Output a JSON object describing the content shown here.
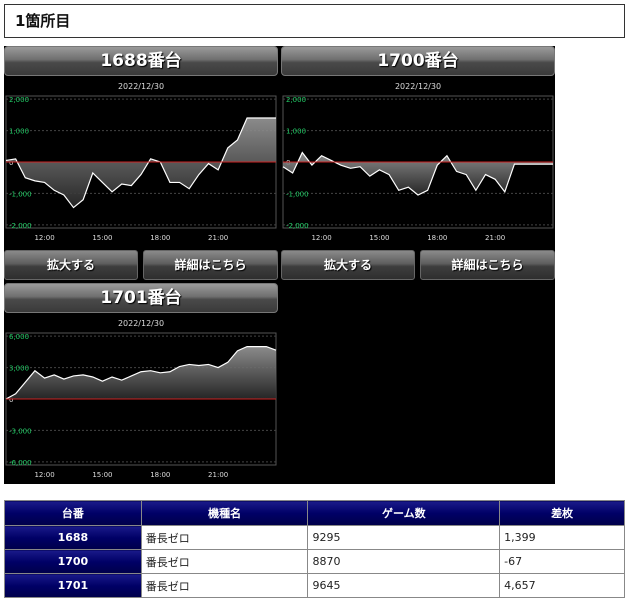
{
  "page": {
    "title": "1箇所目"
  },
  "machines": [
    {
      "title": "1688番台",
      "date": "2022/12/30",
      "zoom_label": "拡大する",
      "detail_label": "詳細はこちら",
      "chart_data": {
        "type": "area",
        "title": "1688番台",
        "subtitle": "2022/12/30",
        "x_ticks": [
          "12:00",
          "15:00",
          "18:00",
          "21:00"
        ],
        "y_ticks": [
          "2,000",
          "1,000",
          "0",
          "-1,000",
          "-2,000"
        ],
        "ylim": [
          -2100,
          2100
        ],
        "xlim": [
          10,
          24
        ],
        "grid": true,
        "series": [
          {
            "x": [
              10,
              10.5,
              11,
              11.5,
              12,
              12.5,
              13,
              13.5,
              14,
              14.5,
              15,
              15.5,
              16,
              16.5,
              17,
              17.5,
              18,
              18.5,
              19,
              19.5,
              20,
              20.5,
              21,
              21.5,
              22,
              22.5,
              23,
              23.5,
              24
            ],
            "y": [
              50,
              100,
              -500,
              -600,
              -650,
              -900,
              -1050,
              -1450,
              -1200,
              -350,
              -650,
              -950,
              -700,
              -750,
              -400,
              100,
              0,
              -650,
              -650,
              -850,
              -400,
              -50,
              -250,
              450,
              700,
              1400,
              1400,
              1400,
              1399
            ]
          }
        ]
      }
    },
    {
      "title": "1700番台",
      "date": "2022/12/30",
      "zoom_label": "拡大する",
      "detail_label": "詳細はこちら",
      "chart_data": {
        "type": "area",
        "title": "1700番台",
        "subtitle": "2022/12/30",
        "x_ticks": [
          "12:00",
          "15:00",
          "18:00",
          "21:00"
        ],
        "y_ticks": [
          "2,000",
          "1,000",
          "0",
          "-1,000",
          "-2,000"
        ],
        "ylim": [
          -2100,
          2100
        ],
        "xlim": [
          10,
          24
        ],
        "grid": true,
        "series": [
          {
            "x": [
              10,
              10.5,
              11,
              11.5,
              12,
              12.5,
              13,
              13.5,
              14,
              14.5,
              15,
              15.5,
              16,
              16.5,
              17,
              17.5,
              18,
              18.5,
              19,
              19.5,
              20,
              20.5,
              21,
              21.5,
              22,
              22.5,
              23,
              23.5,
              24
            ],
            "y": [
              -150,
              -350,
              300,
              -100,
              200,
              50,
              -100,
              -200,
              -150,
              -450,
              -250,
              -400,
              -900,
              -800,
              -1050,
              -900,
              -100,
              200,
              -300,
              -400,
              -900,
              -400,
              -550,
              -950,
              -67,
              -67,
              -67,
              -67,
              -67
            ]
          }
        ]
      }
    },
    {
      "title": "1701番台",
      "date": "2022/12/30",
      "chart_data": {
        "type": "area",
        "title": "1701番台",
        "subtitle": "2022/12/30",
        "x_ticks": [
          "12:00",
          "15:00",
          "18:00",
          "21:00"
        ],
        "y_ticks": [
          "6,000",
          "3,000",
          "0",
          "-3,000",
          "-6,000"
        ],
        "ylim": [
          -6300,
          6300
        ],
        "xlim": [
          10,
          24
        ],
        "grid": true,
        "series": [
          {
            "x": [
              10,
              10.5,
              11,
              11.5,
              12,
              12.5,
              13,
              13.5,
              14,
              14.5,
              15,
              15.5,
              16,
              16.5,
              17,
              17.5,
              18,
              18.5,
              19,
              19.5,
              20,
              20.5,
              21,
              21.5,
              22,
              22.5,
              23,
              23.5,
              24
            ],
            "y": [
              0,
              500,
              1600,
              2700,
              2000,
              2300,
              1900,
              2200,
              2300,
              2100,
              1700,
              2100,
              1800,
              2200,
              2600,
              2700,
              2500,
              2600,
              3100,
              3300,
              3200,
              3300,
              3000,
              3500,
              4600,
              5000,
              5000,
              5000,
              4657
            ]
          }
        ]
      }
    }
  ],
  "table": {
    "headers": [
      "台番",
      "機種名",
      "ゲーム数",
      "差枚"
    ],
    "rows": [
      {
        "num": "1688",
        "model": "番長ゼロ",
        "games": "9295",
        "diff": "1,399",
        "negative": false
      },
      {
        "num": "1700",
        "model": "番長ゼロ",
        "games": "8870",
        "diff": "-67",
        "negative": true
      },
      {
        "num": "1701",
        "model": "番長ゼロ",
        "games": "9645",
        "diff": "4,657",
        "negative": false
      }
    ]
  }
}
